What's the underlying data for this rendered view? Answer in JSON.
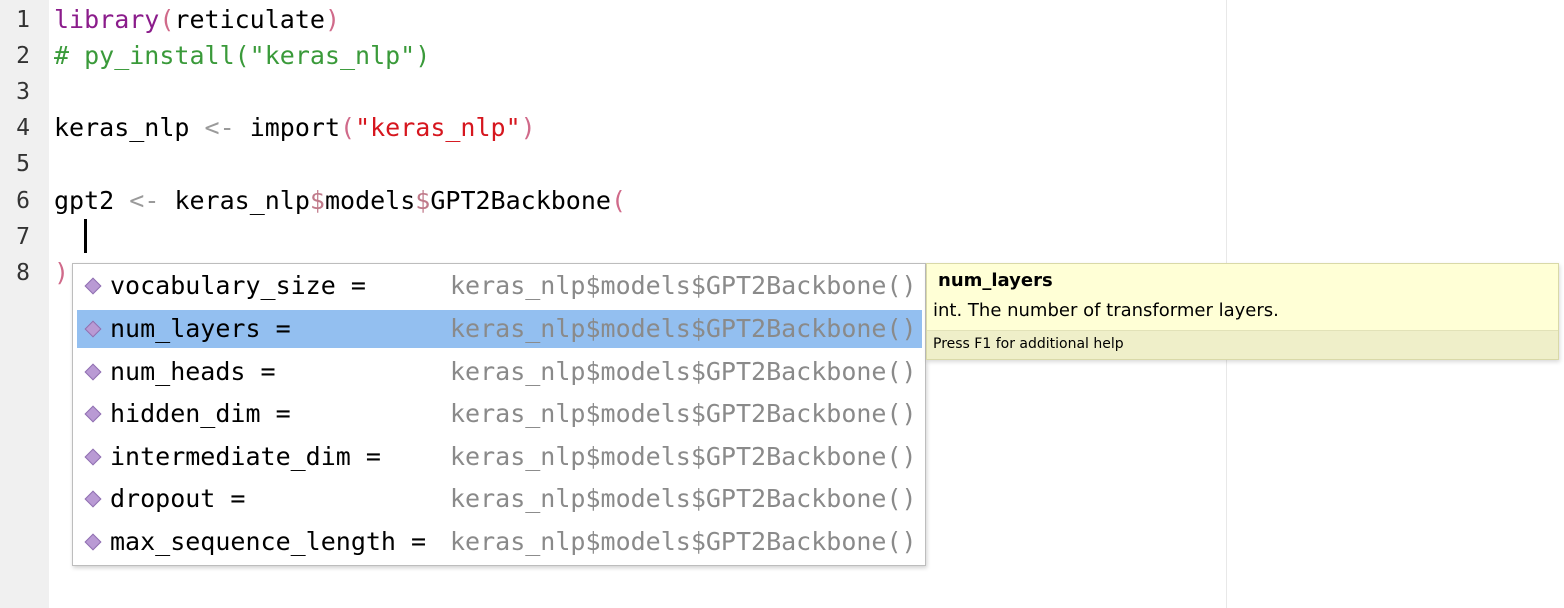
{
  "editor": {
    "line_numbers": [
      "1",
      "2",
      "3",
      "4",
      "5",
      "6",
      "7",
      "8"
    ],
    "lines": {
      "l1": {
        "fn": "library",
        "open": "(",
        "arg": "reticulate",
        "close": ")"
      },
      "l2": {
        "comment": "# py_install(\"keras_nlp\")"
      },
      "l4": {
        "var": "keras_nlp ",
        "op": "<-",
        "sp": " ",
        "fn": "import",
        "open": "(",
        "str": "\"keras_nlp\"",
        "close": ")"
      },
      "l6": {
        "var": "gpt2 ",
        "op": "<-",
        "sp": " ",
        "obj": "keras_nlp",
        "d1": "$",
        "mod": "models",
        "d2": "$",
        "cls": "GPT2Backbone",
        "open": "("
      },
      "l8": {
        "close": ")"
      }
    }
  },
  "completion": {
    "items": [
      {
        "name": "vocabulary_size =",
        "source": "keras_nlp$models$GPT2Backbone()"
      },
      {
        "name": "num_layers =",
        "source": "keras_nlp$models$GPT2Backbone()"
      },
      {
        "name": "num_heads =",
        "source": "keras_nlp$models$GPT2Backbone()"
      },
      {
        "name": "hidden_dim =",
        "source": "keras_nlp$models$GPT2Backbone()"
      },
      {
        "name": "intermediate_dim =",
        "source": "keras_nlp$models$GPT2Backbone()"
      },
      {
        "name": "dropout =",
        "source": "keras_nlp$models$GPT2Backbone()"
      },
      {
        "name": "max_sequence_length =",
        "source": "keras_nlp$models$GPT2Backbone()"
      }
    ],
    "selected_index": 1,
    "icon": "argument-diamond-icon"
  },
  "help": {
    "title": "num_layers",
    "description": "int. The number of transformer layers.",
    "footer": "Press F1 for additional help"
  },
  "colors": {
    "function": "#8b1c8b",
    "string": "#d6161e",
    "comment": "#3a9a3a",
    "selection": "#93bff0",
    "tooltip_bg": "#ffffd6"
  }
}
